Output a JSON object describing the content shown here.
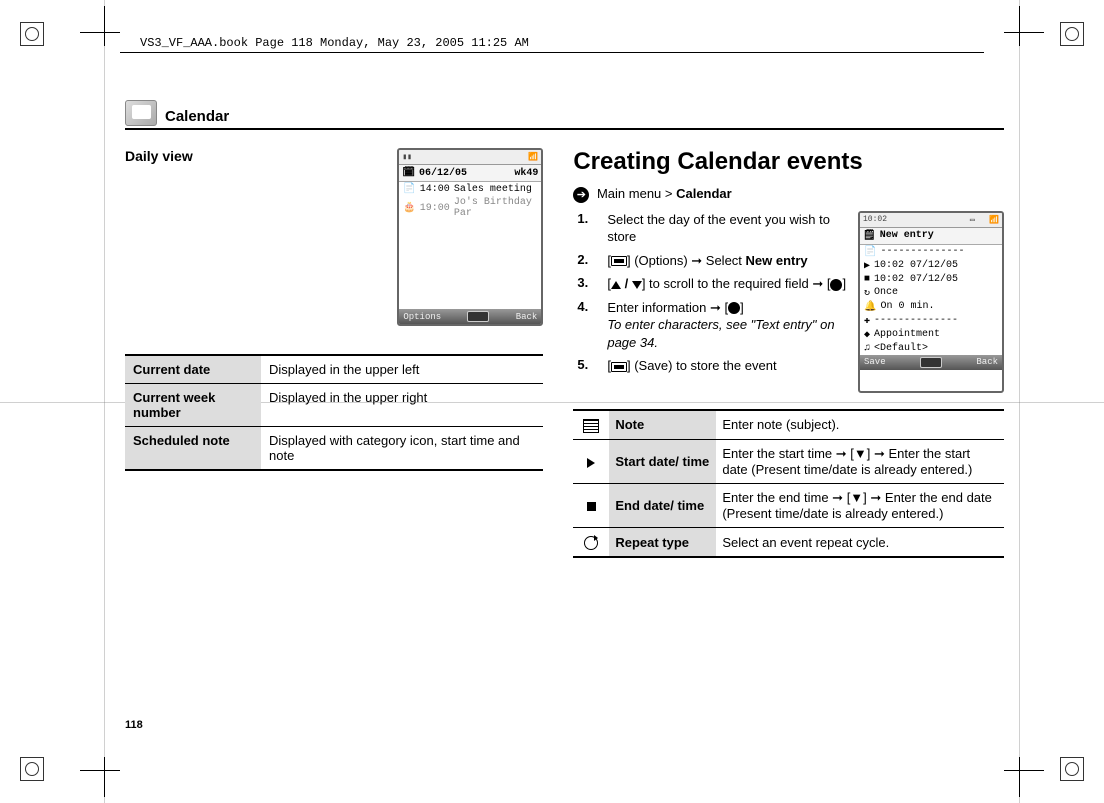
{
  "header_note": "VS3_VF_AAA.book  Page 118  Monday, May 23, 2005  11:25 AM",
  "section_title": "Calendar",
  "page_number": "118",
  "left": {
    "subhead": "Daily view",
    "phone": {
      "date": "06/12/05",
      "week": "wk49",
      "rows": [
        {
          "time": "14:00",
          "text": "Sales meeting",
          "dim": false
        },
        {
          "time": "19:00",
          "text": "Jo's Birthday Par",
          "dim": true
        }
      ],
      "soft_left": "Options",
      "soft_right": "Back"
    },
    "table": [
      {
        "k": "Current date",
        "v": "Displayed in the upper left"
      },
      {
        "k": "Current week number",
        "v": "Displayed in the upper right"
      },
      {
        "k": "Scheduled note",
        "v": "Displayed with category icon, start time and note"
      }
    ]
  },
  "right": {
    "heading": "Creating Calendar events",
    "breadcrumb_pre": "Main menu > ",
    "breadcrumb_bold": "Calendar",
    "steps": {
      "s1": "Select the day of the event you wish to store",
      "s2_pre": "(Options) ➞ Select ",
      "s2_bold": "New entry",
      "s3_pre": "to scroll to the required field ➞ ",
      "s4_pre": "Enter information ➞ ",
      "s4_note": "To enter characters, see \"Text entry\" on page 34.",
      "s5": "(Save) to store the event"
    },
    "phone": {
      "time": "10:02",
      "title": "New entry",
      "rows": [
        "--------------",
        "10:02 07/12/05",
        "10:02 07/12/05",
        "Once",
        "On 0 min.",
        "--------------",
        "Appointment",
        "<Default>"
      ],
      "soft_left": "Save",
      "soft_right": "Back"
    },
    "table": [
      {
        "icon": "note",
        "k": "Note",
        "v": "Enter note (subject)."
      },
      {
        "icon": "play",
        "k": "Start date/ time",
        "v": "Enter the start time ➞ [▼] ➞ Enter the start date (Present time/date is already entered.)"
      },
      {
        "icon": "stop",
        "k": "End date/ time",
        "v": "Enter the end time ➞ [▼] ➞ Enter the end date (Present time/date is already entered.)"
      },
      {
        "icon": "repeat",
        "k": "Repeat type",
        "v": "Select an event repeat cycle."
      }
    ]
  }
}
